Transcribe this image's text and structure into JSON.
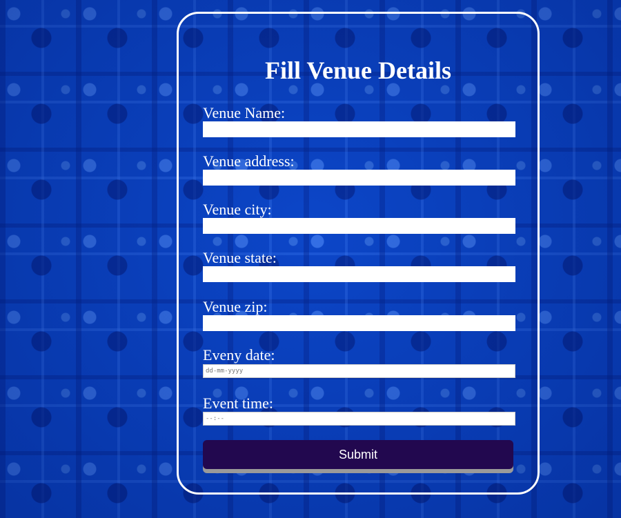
{
  "form": {
    "title": "Fill Venue Details",
    "fields": [
      {
        "label": "Venue Name:",
        "value": ""
      },
      {
        "label": "Venue address:",
        "value": ""
      },
      {
        "label": "Venue city:",
        "value": ""
      },
      {
        "label": "Venue state:",
        "value": ""
      },
      {
        "label": "Venue zip:",
        "value": ""
      },
      {
        "label": "Eveny date:",
        "placeholder": "dd-mm-yyyy"
      },
      {
        "label": "Event time:",
        "placeholder": "--:--"
      }
    ],
    "submit_label": "Submit"
  },
  "colors": {
    "background": "#0a44c4",
    "submit_button": "#22084f",
    "text": "#ffffff"
  }
}
